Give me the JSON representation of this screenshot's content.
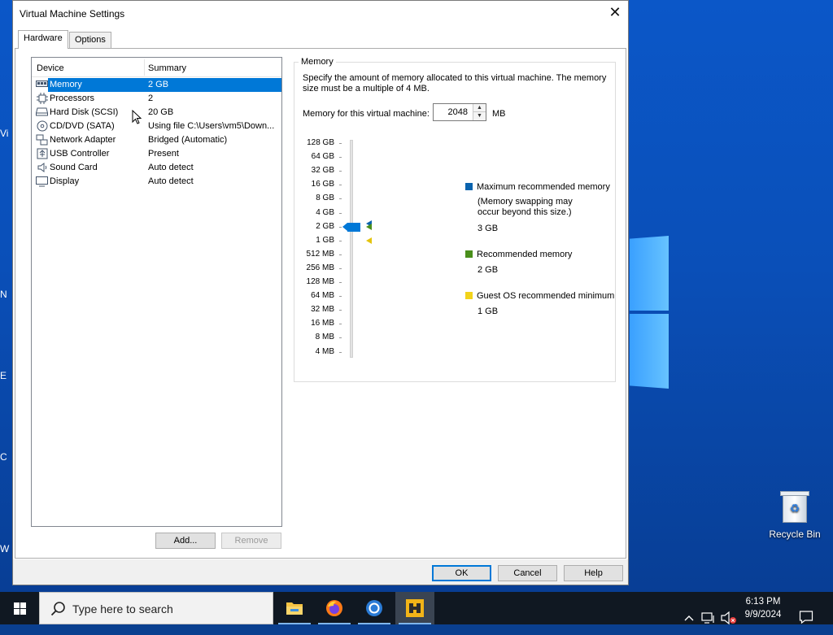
{
  "desktop": {
    "edge_letters": [
      "Vi",
      "N",
      "E",
      "C",
      "W"
    ],
    "recycle_bin_label": "Recycle Bin"
  },
  "dialog": {
    "title": "Virtual Machine Settings",
    "tabs": [
      {
        "label": "Hardware",
        "active": true
      },
      {
        "label": "Options",
        "active": false
      }
    ],
    "device_list": {
      "columns": [
        "Device",
        "Summary"
      ],
      "rows": [
        {
          "icon": "memory-icon",
          "name": "Memory",
          "summary": "2 GB",
          "selected": true
        },
        {
          "icon": "processor-icon",
          "name": "Processors",
          "summary": "2",
          "selected": false
        },
        {
          "icon": "hard-disk-icon",
          "name": "Hard Disk (SCSI)",
          "summary": "20 GB",
          "selected": false
        },
        {
          "icon": "cd-dvd-icon",
          "name": "CD/DVD (SATA)",
          "summary": "Using file C:\\Users\\vm5\\Down...",
          "selected": false
        },
        {
          "icon": "network-adapter-icon",
          "name": "Network Adapter",
          "summary": "Bridged (Automatic)",
          "selected": false
        },
        {
          "icon": "usb-icon",
          "name": "USB Controller",
          "summary": "Present",
          "selected": false
        },
        {
          "icon": "sound-card-icon",
          "name": "Sound Card",
          "summary": "Auto detect",
          "selected": false
        },
        {
          "icon": "display-icon",
          "name": "Display",
          "summary": "Auto detect",
          "selected": false
        }
      ]
    },
    "add_button": "Add...",
    "remove_button": "Remove",
    "memory": {
      "group_label": "Memory",
      "description": "Specify the amount of memory allocated to this virtual machine. The memory size must be a multiple of 4 MB.",
      "field_label": "Memory for this virtual machine:",
      "value": "2048",
      "unit": "MB",
      "scale": [
        "128 GB",
        "64 GB",
        "32 GB",
        "16 GB",
        "8 GB",
        "4 GB",
        "2 GB",
        "1 GB",
        "512 MB",
        "256 MB",
        "128 MB",
        "64 MB",
        "32 MB",
        "16 MB",
        "8 MB",
        "4 MB"
      ],
      "slider_value": "2 GB",
      "legend": {
        "max_title": "Maximum recommended memory",
        "max_note": "(Memory swapping may occur beyond this size.)",
        "max_value": "3 GB",
        "rec_title": "Recommended memory",
        "rec_value": "2 GB",
        "min_title": "Guest OS recommended minimum",
        "min_value": "1 GB"
      },
      "colors": {
        "max": "#0a63ae",
        "rec": "#4a8f1c",
        "min": "#f2d31b",
        "slider": "#0078d7"
      }
    },
    "buttons": {
      "ok": "OK",
      "cancel": "Cancel",
      "help": "Help"
    }
  },
  "taskbar": {
    "search_placeholder": "Type here to search",
    "apps": [
      "file-explorer-icon",
      "firefox-icon",
      "chrome-icon",
      "vmware-workstation-icon"
    ],
    "time": "6:13 PM",
    "date": "9/9/2024"
  }
}
